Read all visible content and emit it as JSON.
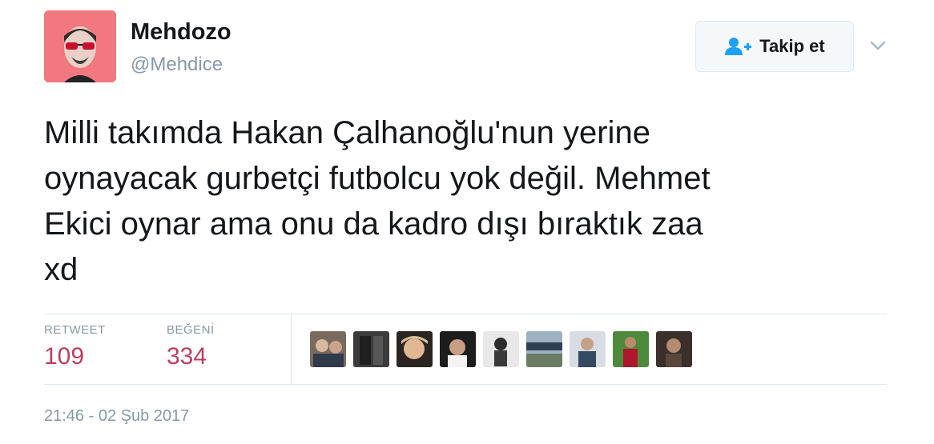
{
  "user": {
    "display_name": "Mehdozo",
    "handle": "@Mehdice",
    "avatar_bg": "#f0787e"
  },
  "follow": {
    "label": "Takip et",
    "icon": "follow-user-icon"
  },
  "menu_icon": "chevron-down-icon",
  "tweet": {
    "text": "Milli takımda Hakan Çalhanoğlu'nun yerine\noynayacak gurbetçi futbolcu yok değil. Mehmet\nEkici oynar ama onu da kadro dışı bıraktık zaa\nxd"
  },
  "stats": {
    "retweet_label": "RETWEET",
    "retweet_count": "109",
    "like_label": "BEĞENİ",
    "like_count": "334"
  },
  "likers_count_shown": 9,
  "timestamp": "21:46 - 02 Şub 2017",
  "colors": {
    "stat_value": "#b8405e",
    "muted": "#8899a6",
    "text": "#14171a",
    "button_icon": "#1da1f2"
  }
}
